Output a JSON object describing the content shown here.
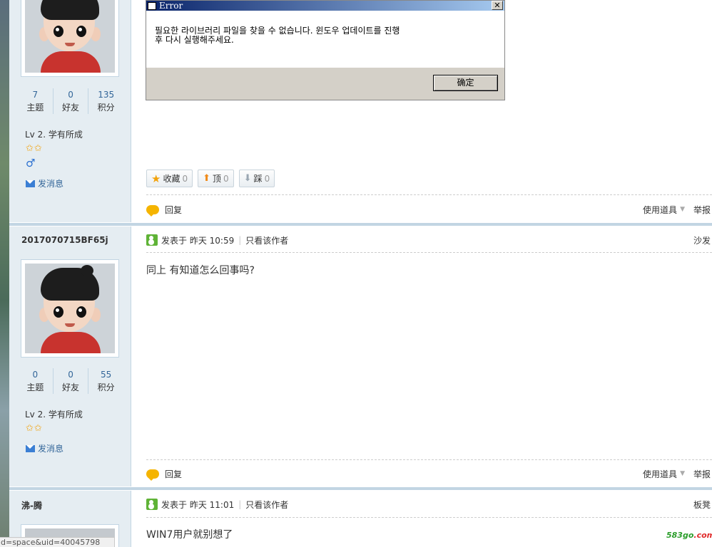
{
  "posts": [
    {
      "stats": [
        {
          "num": "7",
          "label": "主题"
        },
        {
          "num": "0",
          "label": "好友"
        },
        {
          "num": "135",
          "label": "积分"
        }
      ],
      "level": "Lv 2. 学有所成",
      "stars": "✩✩",
      "gender": "♂",
      "send_message": "发消息",
      "error_dialog": {
        "title": "Error",
        "message_line1": "필요한 라이브러리 파일을 찾을 수 없습니다. 윈도우 업데이트를 진행",
        "message_line2": "후 다시 실행해주세요.",
        "ok_label": "确定",
        "close_glyph": "✕"
      },
      "buttons": [
        {
          "label": "收藏",
          "count": "0"
        },
        {
          "label": "顶",
          "count": "0"
        },
        {
          "label": "踩",
          "count": "0"
        }
      ],
      "reply_label": "回复",
      "tools_label": "使用道具",
      "report_label": "举报"
    },
    {
      "username": "2017070715BF65j",
      "posted_at": "发表于 昨天 10:59",
      "only_author": "只看该作者",
      "floor": "沙发",
      "content": "同上 有知道怎么回事吗?",
      "stats": [
        {
          "num": "0",
          "label": "主题"
        },
        {
          "num": "0",
          "label": "好友"
        },
        {
          "num": "55",
          "label": "积分"
        }
      ],
      "level": "Lv 2. 学有所成",
      "stars": "✩✩",
      "send_message": "发消息",
      "reply_label": "回复",
      "tools_label": "使用道具",
      "report_label": "举报"
    },
    {
      "username": "沸-腾",
      "posted_at": "发表于 昨天 11:01",
      "only_author": "只看该作者",
      "floor": "板凳",
      "content": "WIN7用户就别想了"
    }
  ],
  "watermark": {
    "part1": "583go",
    "part2": ".com"
  },
  "status_url": "d=space&uid=40045798",
  "icons": [
    "star-icon",
    "thumb-up-icon",
    "thumb-down-icon",
    "reply-icon",
    "mail-icon",
    "online-icon",
    "male-icon",
    "avatar"
  ],
  "colors": {
    "sidebar_bg": "#e5edf2",
    "border": "#c2d5e3",
    "link": "#336699",
    "star": "#f2a20a"
  }
}
